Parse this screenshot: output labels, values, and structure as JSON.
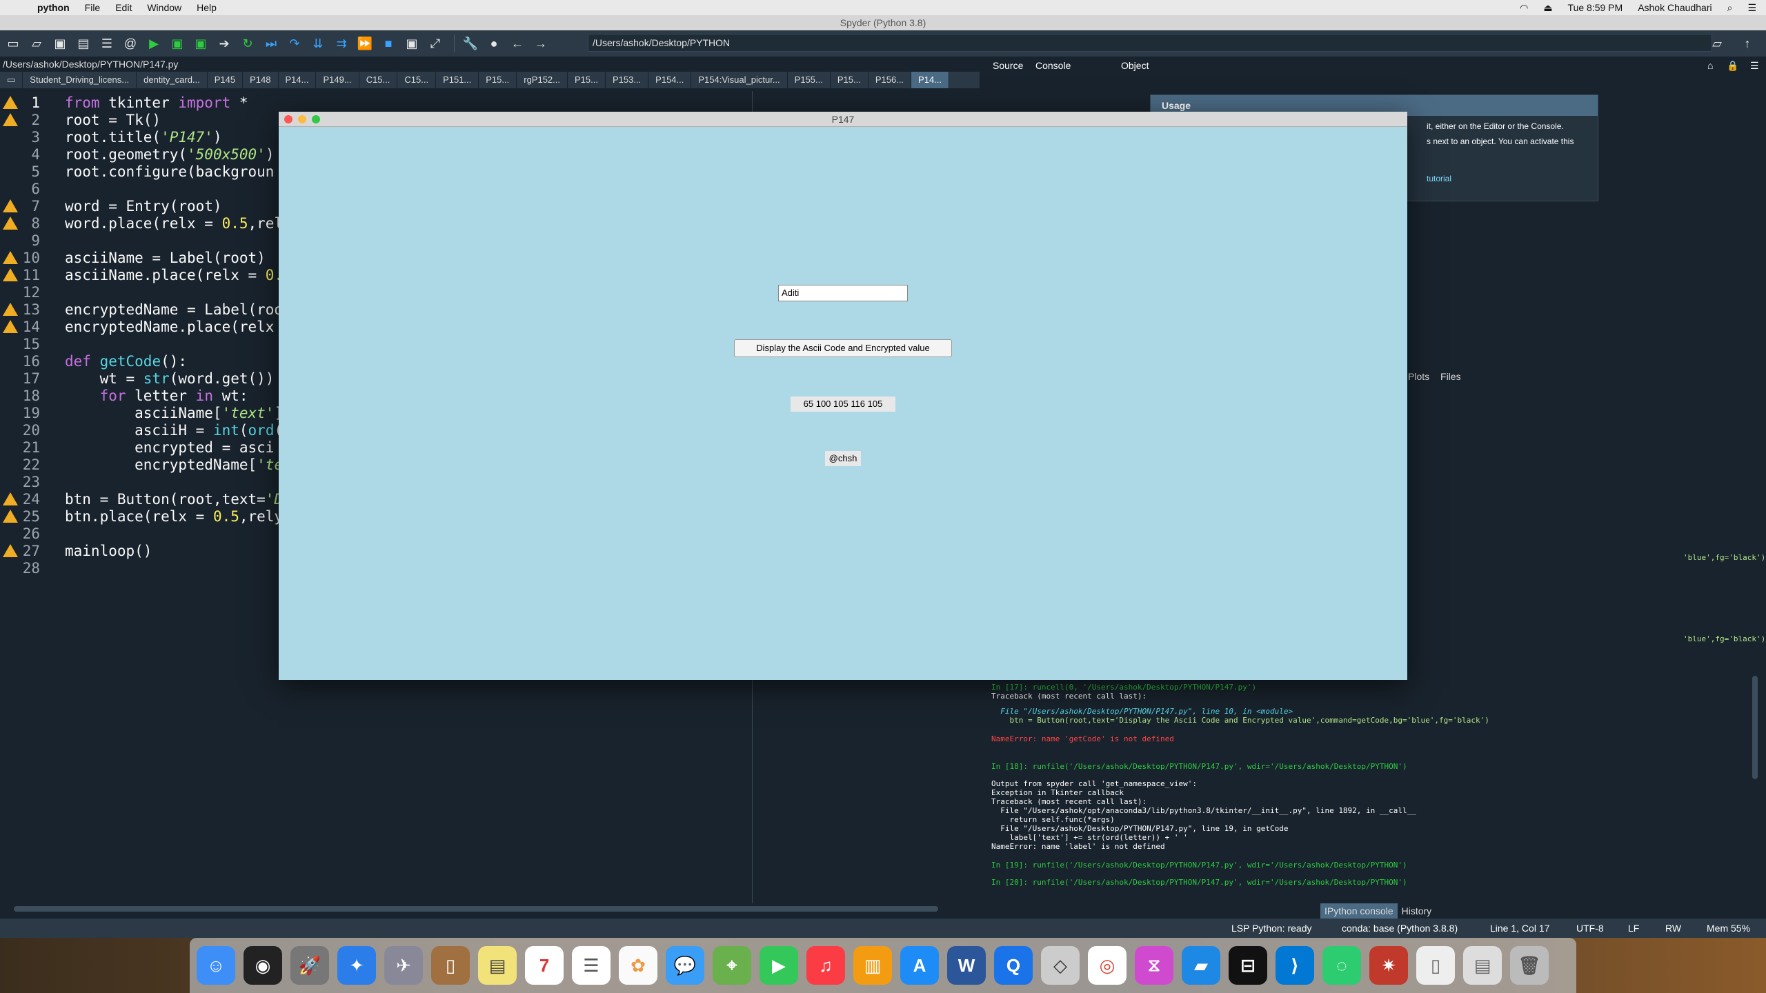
{
  "menubar": {
    "app": "python",
    "items": [
      "File",
      "Edit",
      "Window",
      "Help"
    ],
    "clock": "Tue 8:59 PM",
    "user": "Ashok Chaudhari"
  },
  "window_title": "Spyder (Python 3.8)",
  "toolbar": {
    "path": "/Users/ashok/Desktop/PYTHON"
  },
  "editor": {
    "file_path": "/Users/ashok/Desktop/PYTHON/P147.py",
    "tabs": [
      "Student_Driving_licens...",
      "dentity_card...",
      "P145",
      "P148",
      "P14...",
      "P149...",
      "C15...",
      "C15...",
      "P151...",
      "P15...",
      "rgP152...",
      "P15...",
      "P153...",
      "P154...",
      "P154:Visual_pictur...",
      "P155...",
      "P15...",
      "P156...",
      "P14..."
    ],
    "line_numbers": [
      "1",
      "2",
      "3",
      "4",
      "5",
      "6",
      "7",
      "8",
      "9",
      "10",
      "11",
      "12",
      "13",
      "14",
      "15",
      "16",
      "17",
      "18",
      "19",
      "20",
      "21",
      "22",
      "23",
      "24",
      "25",
      "26",
      "27",
      "28"
    ],
    "warning_lines": [
      1,
      2,
      7,
      8,
      10,
      11,
      13,
      14,
      24,
      25,
      27
    ]
  },
  "help_pane": {
    "tabs": {
      "source": "Source",
      "console": "Console",
      "object": "Object"
    },
    "usage_title": "Usage",
    "usage_line1": "it, either on the Editor or the Console.",
    "usage_line2": "s next to an object. You can activate this",
    "usage_link": "tutorial",
    "lower_tabs": [
      "Plots",
      "Files"
    ]
  },
  "console_lines": {
    "l1": "'blue',fg='black')",
    "l2": "'blue',fg='black')",
    "l3": "In [17]: runcell(0, '/Users/ashok/Desktop/PYTHON/P147.py')",
    "l4": "Traceback (most recent call last):",
    "l5": "  File \"/Users/ashok/Desktop/PYTHON/P147.py\", line 10, in <module>",
    "l6": "    btn = Button(root,text='Display the Ascii Code and Encrypted value',command=getCode,bg='blue',fg='black')",
    "l7": "NameError: name 'getCode' is not defined",
    "l8": "In [18]: runfile('/Users/ashok/Desktop/PYTHON/P147.py', wdir='/Users/ashok/Desktop/PYTHON')",
    "l9": "Output from spyder call 'get_namespace_view':",
    "l10": "Exception in Tkinter callback",
    "l11": "Traceback (most recent call last):",
    "l12": "  File \"/Users/ashok/opt/anaconda3/lib/python3.8/tkinter/__init__.py\", line 1892, in __call__",
    "l13": "    return self.func(*args)",
    "l14": "  File \"/Users/ashok/Desktop/PYTHON/P147.py\", line 19, in getCode",
    "l15": "    label['text'] += str(ord(letter)) + ' '",
    "l16": "NameError: name 'label' is not defined",
    "l17": "In [19]: runfile('/Users/ashok/Desktop/PYTHON/P147.py', wdir='/Users/ashok/Desktop/PYTHON')",
    "l18": "In [20]: runfile('/Users/ashok/Desktop/PYTHON/P147.py', wdir='/Users/ashok/Desktop/PYTHON')"
  },
  "bottom_tabs": {
    "ipython": "IPython console",
    "history": "History"
  },
  "status_bar": {
    "lsp": "LSP Python: ready",
    "conda": "conda: base (Python 3.8.8)",
    "position": "Line 1, Col 17",
    "encoding": "UTF-8",
    "eol": "LF",
    "perm": "RW",
    "mem": "Mem 55%"
  },
  "tk_window": {
    "title": "P147",
    "entry_value": "Aditi",
    "button_label": "Display the Ascii Code and Encrypted value",
    "ascii_label": "65 100 105 116 105",
    "encrypted_label": "@chsh"
  },
  "colors": {
    "tk_background": "#add8e6",
    "spyder_background": "#19232d",
    "warning": "#f0ac23"
  }
}
